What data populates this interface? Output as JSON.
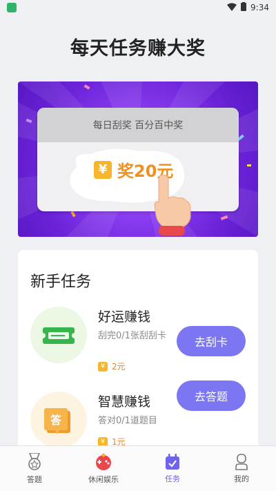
{
  "status_bar": {
    "time": "9:34"
  },
  "page": {
    "title": "每天任务赚大奖"
  },
  "banner": {
    "card_header": "每日刮奖 百分百中奖",
    "prize_symbol": "¥",
    "prize_text": "奖20元"
  },
  "tasks_section": {
    "title": "新手任务",
    "tasks": [
      {
        "name": "好运赚钱",
        "desc": "刮完0/1张刮刮卡",
        "reward": "2元",
        "button": "去刮卡",
        "icon": "ticket-icon",
        "icon_bg": "#ecf7e4"
      },
      {
        "name": "智慧赚钱",
        "desc": "答对0/1道题目",
        "reward": "1元",
        "button": "去答题",
        "icon": "answer-icon",
        "icon_bg": "#fdf3e1"
      }
    ]
  },
  "bottom_nav": {
    "items": [
      {
        "label": "答题",
        "icon": "medal-icon"
      },
      {
        "label": "休闲娱乐",
        "icon": "gamepad-icon"
      },
      {
        "label": "任务",
        "icon": "calendar-check-icon",
        "active": true
      },
      {
        "label": "我的",
        "icon": "user-icon"
      }
    ]
  },
  "colors": {
    "accent": "#7c76f2",
    "banner_purple": "#7a2fe6",
    "reward_orange": "#e2892a"
  }
}
